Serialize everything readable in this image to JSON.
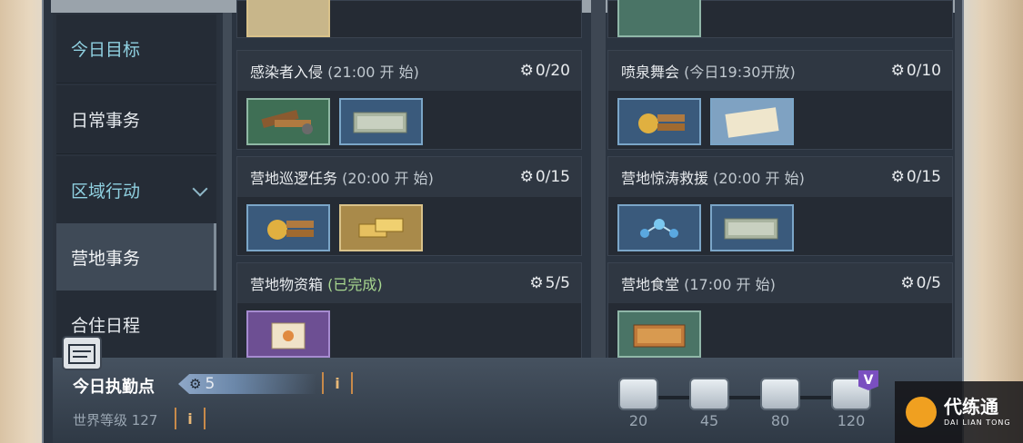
{
  "sidebar": {
    "items": [
      {
        "label": "今日目标"
      },
      {
        "label": "日常事务"
      },
      {
        "label": "区域行动"
      },
      {
        "label": "营地事务"
      },
      {
        "label": "合住日程"
      }
    ]
  },
  "cards": [
    {
      "title": "感染者入侵",
      "note": "(21:00 开 始)",
      "count": "0/20",
      "items": [
        "wood-tools-icon",
        "cash-icon"
      ]
    },
    {
      "title": "喷泉舞会",
      "note": "(今日19:30开放)",
      "count": "0/10",
      "items": [
        "gear-wood-icon",
        "ticket-icon"
      ]
    },
    {
      "title": "营地巡逻任务",
      "note": "(20:00 开 始)",
      "count": "0/15",
      "items": [
        "gear-wood-icon",
        "gold-bars-icon"
      ]
    },
    {
      "title": "营地惊涛救援",
      "note": "(20:00 开 始)",
      "count": "0/15",
      "items": [
        "molecule-icon",
        "cash-icon"
      ]
    },
    {
      "title": "营地物资箱",
      "note": "(已完成)",
      "count": "5/5",
      "items": [
        "supply-box-icon"
      ]
    },
    {
      "title": "营地食堂",
      "note": "(17:00 开 始)",
      "count": "0/5",
      "items": [
        "food-tray-icon"
      ]
    }
  ],
  "bottom": {
    "duty_label": "今日执勤点",
    "duty_value": "5",
    "info": "i",
    "world_level": "世界等级 127",
    "chest_labels": [
      "20",
      "45",
      "80",
      "120"
    ],
    "v_badge": "V"
  },
  "logo": {
    "text": "代练通",
    "sub": "DAI LIAN TONG"
  },
  "colors": {
    "accent_cyan": "#8fd0e0",
    "info_orange": "#e8b878",
    "vip_purple": "#7a4fc0"
  }
}
